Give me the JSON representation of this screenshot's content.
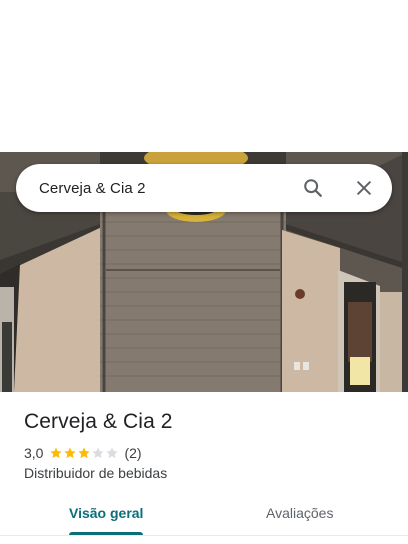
{
  "search": {
    "query": "Cerveja & Cia 2"
  },
  "place": {
    "title": "Cerveja & Cia 2",
    "rating_text": "3,0",
    "rating_value": 3.0,
    "rating_max": 5,
    "review_count": "(2)",
    "category": "Distribuidor de bebidas"
  },
  "tabs": [
    {
      "label": "Visão geral",
      "active": true
    },
    {
      "label": "Avaliações",
      "active": false
    }
  ],
  "colors": {
    "accent": "#0b6e79",
    "star_filled": "#fbbc04",
    "star_empty": "#dadce0"
  },
  "icons": {
    "search": "search-icon",
    "close": "close-icon"
  }
}
